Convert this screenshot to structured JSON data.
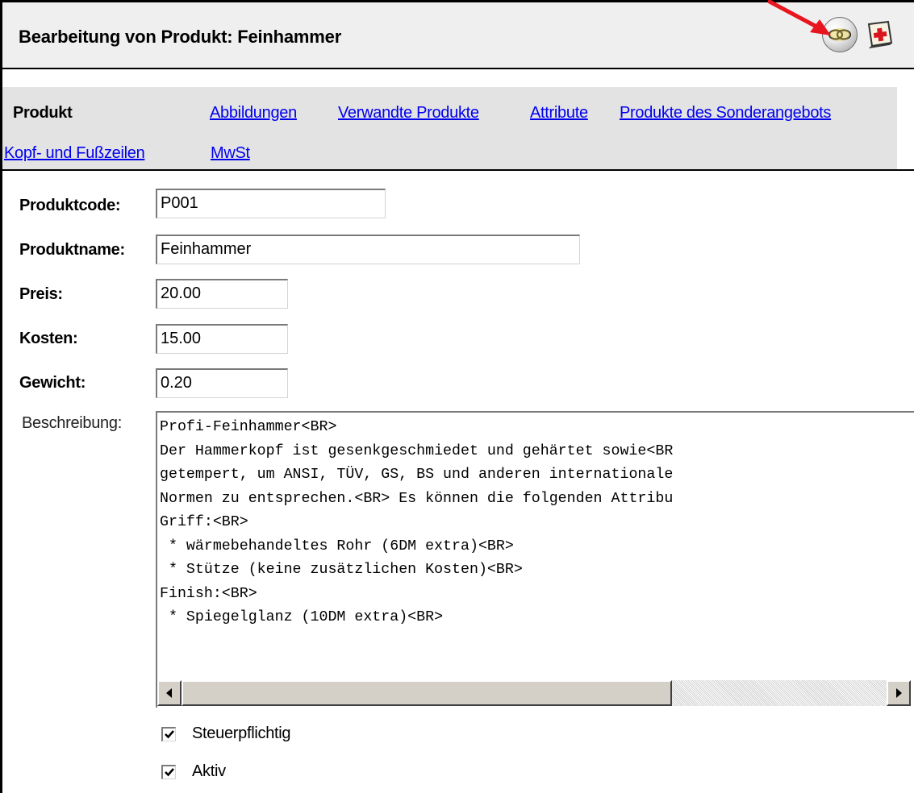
{
  "header": {
    "title": "Bearbeitung von Produkt: Feinhammer",
    "chain_icon": "chain-link-icon",
    "help_icon": "help-book-icon",
    "arrow_color": "#e8141e"
  },
  "tabs": {
    "active": "Produkt",
    "links": [
      "Abbildungen",
      "Verwandte Produkte",
      "Attribute",
      "Produkte des Sonderangebots",
      "Kopf- und Fußzeilen",
      "MwSt"
    ],
    "link_color": "#0000ee"
  },
  "form": {
    "code_label": "Produktcode:",
    "code_value": "P001",
    "name_label": "Produktname:",
    "name_value": "Feinhammer",
    "price_label": "Preis:",
    "price_value": "20.00",
    "cost_label": "Kosten:",
    "cost_value": "15.00",
    "weight_label": "Gewicht:",
    "weight_value": "0.20",
    "description_label": "Beschreibung:",
    "description_value": "Profi-Feinhammer<BR>\nDer Hammerkopf ist gesenkgeschmiedet und gehärtet sowie<BR\ngetempert, um ANSI, TÜV, GS, BS und anderen internationale\nNormen zu entsprechen.<BR> Es können die folgenden Attribu\nGriff:<BR>\n * wärmebehandeltes Rohr (6DM extra)<BR>\n * Stütze (keine zusätzlichen Kosten)<BR>\nFinish:<BR>\n * Spiegelglanz (10DM extra)<BR>",
    "taxable_label": "Steuerpflichtig",
    "taxable_checked": true,
    "active_label": "Aktiv",
    "active_checked": true
  }
}
